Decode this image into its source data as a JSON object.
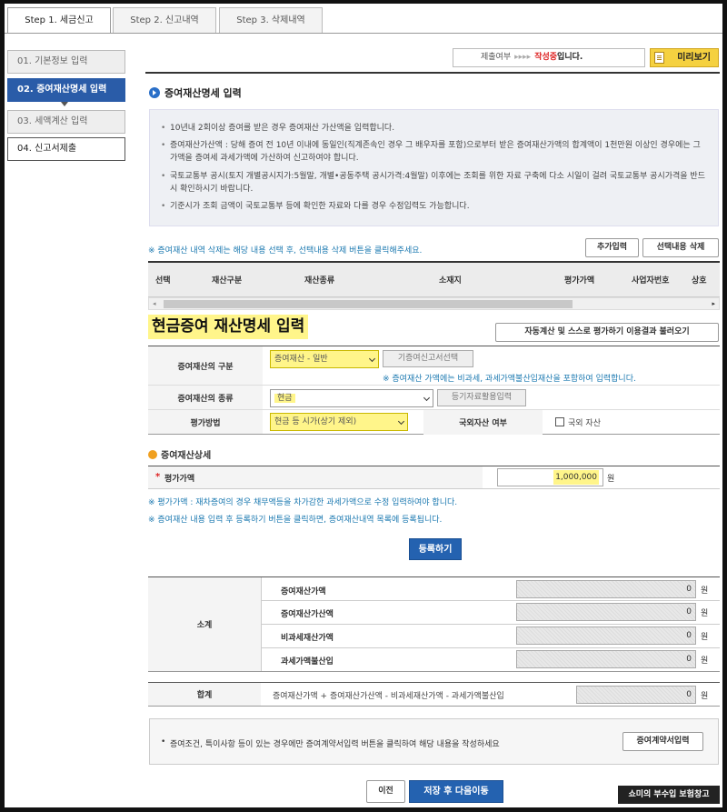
{
  "tabs": [
    {
      "label": "Step 1. 세금신고"
    },
    {
      "label": "Step 2. 신고내역"
    },
    {
      "label": "Step 3. 삭제내역"
    }
  ],
  "sidebar": {
    "items": [
      {
        "label": "01. 기본정보 입력"
      },
      {
        "label": "02. 증여재산명세 입력"
      },
      {
        "label": "03. 세액계산 입력"
      },
      {
        "label": "04. 신고서제출"
      }
    ]
  },
  "status": {
    "prefix": "제출여부",
    "arrows": "▸▸▸▸",
    "state": "작성중",
    "suffix": "입니다.",
    "preview_label": "미리보기"
  },
  "section_title": "증여재산명세 입력",
  "info": [
    "10년내 2회이상 증여를 받은 경우 증여재산 가산액을 입력합니다.",
    "증여재산가산액 : 당해 증여 전 10년 이내에 동일인(직계존속인 경우 그 배우자를 포함)으로부터 받은 증여재산가액의 합계액이 1천만원 이상인 경우에는 그 가액을 증여세 과세가액에 가산하여 신고하여야 합니다.",
    "국토교통부 공시(토지 개별공시지가:5월말, 개별•공동주택 공시가격:4월말) 이후에는 조회를 위한 자료 구축에 다소 시일이 걸려 국토교통부 공시가격을 반드시 확인하시기 바랍니다.",
    "기준시가 조회 금액이 국토교통부 등에 확인한 자료와 다를 경우 수정입력도 가능합니다."
  ],
  "grid_note": "※ 증여재산 내역 삭제는 해당 내용 선택 후, 선택내용 삭제 버튼을  클릭해주세요.",
  "grid_buttons": {
    "add": "추가입력",
    "delete": "선택내용 삭제"
  },
  "grid_columns": [
    "선택",
    "재산구분",
    "재산종류",
    "소재지",
    "평가가액",
    "사업자번호",
    "상호"
  ],
  "big_title": "현금증여 재산명세 입력",
  "auto_calc_button": "자동계산 및 스스로 평가하기 이용결과 불러오기",
  "form": {
    "category_label": "증여재산의 구분",
    "category_value": "증여재산 - 일반",
    "prev_report_button": "기증여신고서선택",
    "category_note": "※ 증여재산 가액에는 비과세, 과세가액불산입재산을 포함하여 입력합니다.",
    "type_label": "증여재산의 종류",
    "type_value": "현금",
    "registry_button": "등기자료활용입력",
    "method_label": "평가방법",
    "method_value": "현금 등 시가(상기 제외)",
    "foreign_label": "국외자산 여부",
    "foreign_checkbox": "국외 자산"
  },
  "detail": {
    "title": "증여재산상세",
    "required_mark": "*",
    "amount_label": "평가가액",
    "amount_value": "1,000,000",
    "unit": "원",
    "note1": "※ 평가가액 : 재차증여의 경우 채무액등을 차가감한 과세가액으로 수정 입력하여야 합니다.",
    "note2": "※ 증여재산 내용 입력 후 등록하기 버튼을 클릭하면, 증여재산내역 목록에 등록됩니다.",
    "register_button": "등록하기"
  },
  "subtotal": {
    "label": "소계",
    "rows": [
      {
        "label": "증여재산가액",
        "value": "0"
      },
      {
        "label": "증여재산가산액",
        "value": "0"
      },
      {
        "label": "비과세재산가액",
        "value": "0"
      },
      {
        "label": "과세가액불산입",
        "value": "0"
      }
    ],
    "unit": "원"
  },
  "total": {
    "label": "합계",
    "formula": "증여재산가액 + 증여재산가산액 - 비과세재산가액 - 과세가액불산입",
    "value": "0",
    "unit": "원"
  },
  "contract": {
    "text": "증여조건, 특이사항 등이 있는 경우에만 증여계약서입력 버튼을 클릭하여 해당 내용을 작성하세요",
    "button": "증여계약서입력"
  },
  "footer": {
    "prev": "이전",
    "save_next": "저장 후 다음이동"
  },
  "watermark": "쇼미의 부수입 보험창고",
  "colors": {
    "accent_blue": "#2a5ca8",
    "highlight_yellow": "#fff58a",
    "status_red": "#d22",
    "note_blue": "#1a78b0"
  }
}
